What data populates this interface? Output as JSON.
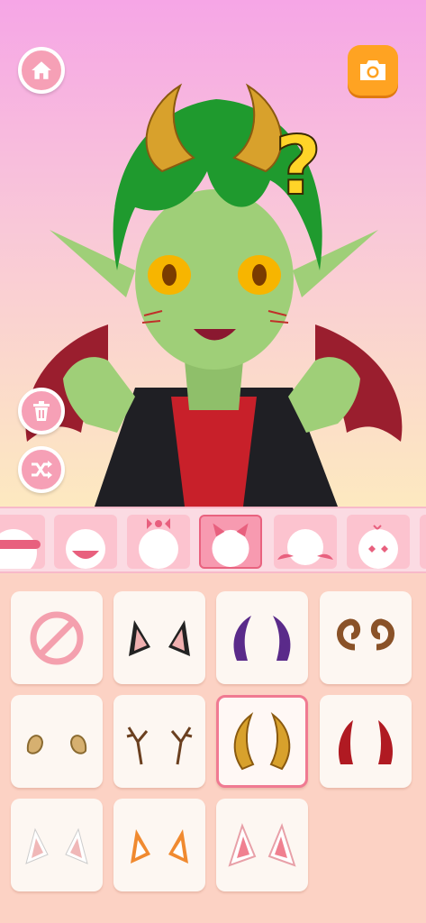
{
  "top_bar": {
    "home_icon": "home-icon",
    "camera_icon": "camera-icon"
  },
  "side_tools": {
    "delete_icon": "trash-icon",
    "shuffle_icon": "shuffle-icon"
  },
  "preview": {
    "overlay_icon": "question-mark-icon"
  },
  "categories": [
    {
      "name": "mask"
    },
    {
      "name": "face-mask"
    },
    {
      "name": "hair-bow"
    },
    {
      "name": "ears-horns",
      "selected": true
    },
    {
      "name": "wings"
    },
    {
      "name": "expression"
    }
  ],
  "items": [
    {
      "name": "none"
    },
    {
      "name": "cat-ears-black"
    },
    {
      "name": "purple-horns"
    },
    {
      "name": "ram-horns-brown"
    },
    {
      "name": "small-curled-horns"
    },
    {
      "name": "antlers"
    },
    {
      "name": "gold-horns",
      "selected": true
    },
    {
      "name": "red-devil-horns"
    },
    {
      "name": "white-cat-ears"
    },
    {
      "name": "fox-ears-orange"
    },
    {
      "name": "pink-fluffy-ears"
    }
  ],
  "colors": {
    "accent": "#f6a0b6",
    "selected_border": "#f07a92",
    "camera": "#ffa322"
  }
}
